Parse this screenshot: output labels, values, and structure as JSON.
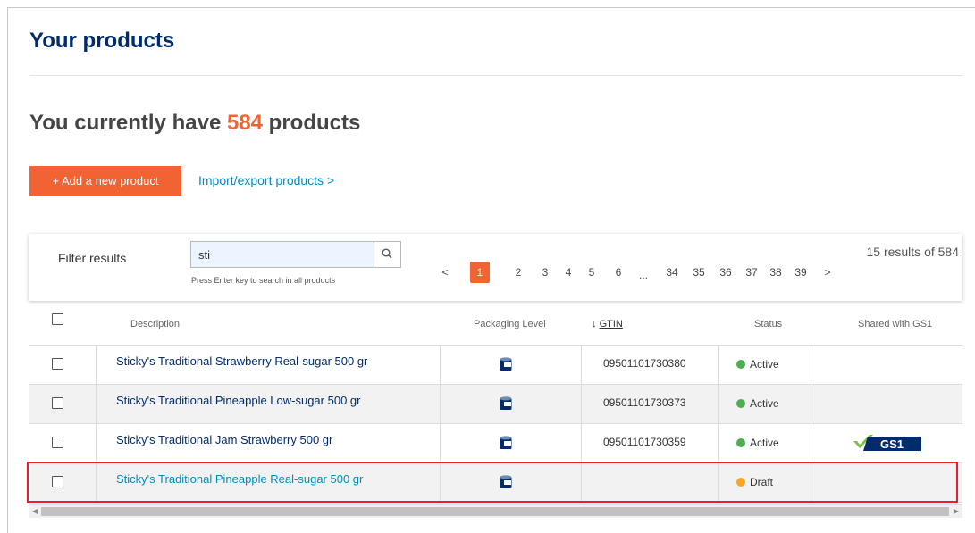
{
  "header": {
    "title": "Your products"
  },
  "summary": {
    "prefix": "You currently have ",
    "count": "584",
    "suffix": " products"
  },
  "actions": {
    "add_label": "+ Add a new product",
    "import_label": "Import/export products >"
  },
  "filter": {
    "label": "Filter results",
    "search_value": "sti",
    "hint": "Press Enter key to search in all products",
    "results": "15 results of 584"
  },
  "pagination": {
    "prev": "<",
    "next": ">",
    "ellipsis": "...",
    "pages": [
      "1",
      "2",
      "3",
      "4",
      "5",
      "6",
      "34",
      "35",
      "36",
      "37",
      "38",
      "39"
    ],
    "active": "1"
  },
  "table": {
    "headers": {
      "description": "Description",
      "packaging": "Packaging Level",
      "gtin_arrow": "↓",
      "gtin": "GTIN",
      "status": "Status",
      "shared": "Shared with GS1"
    },
    "rows": [
      {
        "description": "Sticky's Traditional Strawberry Real-sugar 500 gr",
        "packaging_icon": "can-icon",
        "gtin": "09501101730380",
        "status": "Active",
        "status_color": "#4caf50",
        "shared_gs1": ""
      },
      {
        "description": "Sticky's Traditional Pineapple Low-sugar 500 gr",
        "packaging_icon": "can-icon",
        "gtin": "09501101730373",
        "status": "Active",
        "status_color": "#4caf50",
        "shared_gs1": ""
      },
      {
        "description": "Sticky's Traditional Jam Strawberry 500 gr",
        "packaging_icon": "can-icon",
        "gtin": "09501101730359",
        "status": "Active",
        "status_color": "#4caf50",
        "shared_gs1": "GS1"
      },
      {
        "description": "Sticky's Traditional Pineapple Real-sugar 500 gr",
        "packaging_icon": "can-icon",
        "gtin": "",
        "status": "Draft",
        "status_color": "#f5a623",
        "shared_gs1": ""
      }
    ]
  },
  "colors": {
    "brand_orange": "#f26334",
    "navy": "#002c6c",
    "link_teal": "#008dbd",
    "highlight_red": "#e4202b",
    "gs1_green": "#7ac142"
  }
}
